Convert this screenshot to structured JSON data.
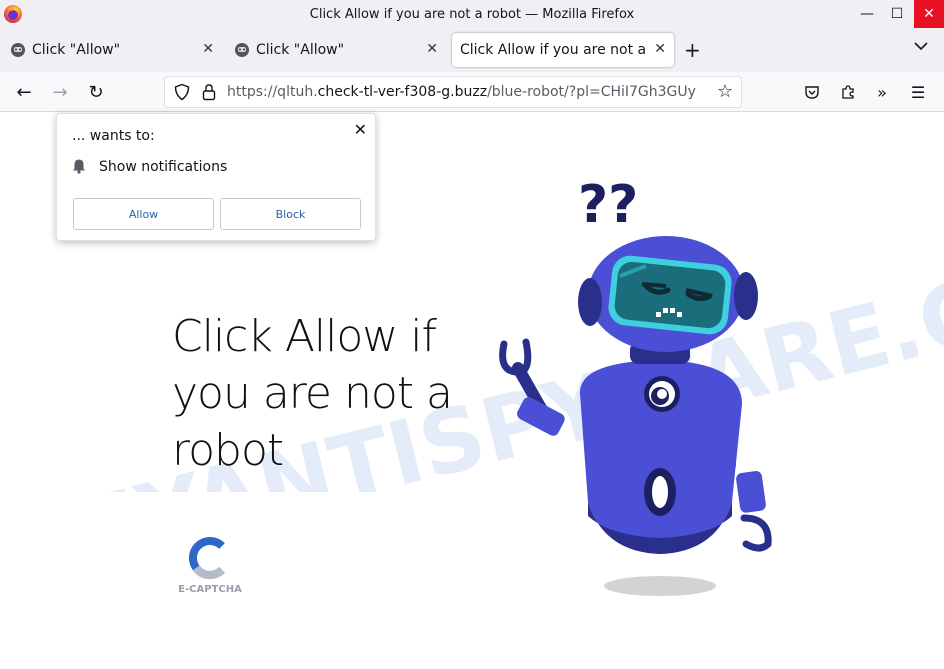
{
  "window": {
    "title": "Click Allow if you are not a robot — Mozilla Firefox",
    "minimize_glyph": "—",
    "maximize_glyph": "☐",
    "close_glyph": "✕"
  },
  "tabs": [
    {
      "label": "Click \"Allow\"",
      "active": false,
      "close_glyph": "✕"
    },
    {
      "label": "Click \"Allow\"",
      "active": false,
      "close_glyph": "✕"
    },
    {
      "label": "Click Allow if you are not a robot",
      "active": true,
      "close_glyph": "✕"
    }
  ],
  "tabstrip": {
    "new_tab_glyph": "+",
    "list_glyph": "⌄"
  },
  "nav": {
    "back_glyph": "←",
    "forward_glyph": "→",
    "reload_glyph": "↻",
    "url_prefix": "https://qltuh.",
    "url_domain": "check-tl-ver-f308-g.buzz",
    "url_suffix": "/blue-robot/?pl=CHiI7Gh3GUy",
    "star_glyph": "☆",
    "more_glyph": "»",
    "menu_glyph": "☰"
  },
  "popup": {
    "wants_to": "... wants to:",
    "permission": "Show notifications",
    "allow_label": "Allow",
    "block_label": "Block",
    "close_glyph": "✕"
  },
  "page": {
    "headline": "Click Allow if you are not a robot",
    "captcha_label": "E-CAPTCHA",
    "watermark": "MYANTISPYWARE.COM"
  },
  "colors": {
    "robot_body": "#4a4fd6",
    "robot_dark": "#2b2f8c",
    "robot_visor": "#1a6d7a",
    "close_red": "#e81123",
    "link_blue": "#2b5fb0"
  }
}
